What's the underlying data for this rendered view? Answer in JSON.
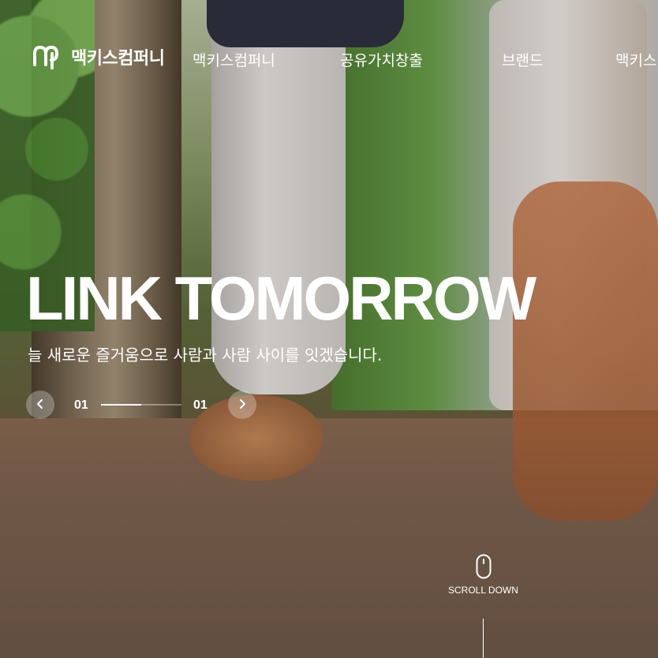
{
  "logo": {
    "text": "맥키스컴퍼니",
    "icon": "brand-logo-mark"
  },
  "nav": {
    "items": [
      {
        "label": "맥키스컴퍼니"
      },
      {
        "label": "공유가치창출"
      },
      {
        "label": "브랜드"
      },
      {
        "label": "맥키스"
      }
    ]
  },
  "hero": {
    "title": "LINK TOMORROW",
    "subtitle": "늘 새로운 즐거움으로 사람과 사람 사이를 잇겠습니다."
  },
  "slider": {
    "current": "01",
    "total": "01",
    "progress": 0.5,
    "prev_icon": "chevron-left-icon",
    "next_icon": "chevron-right-icon"
  },
  "scroll": {
    "label": "SCROLL DOWN",
    "icon": "mouse-icon"
  },
  "colors": {
    "text": "#ffffff",
    "control_bg": "rgba(255,255,255,0.28)"
  }
}
